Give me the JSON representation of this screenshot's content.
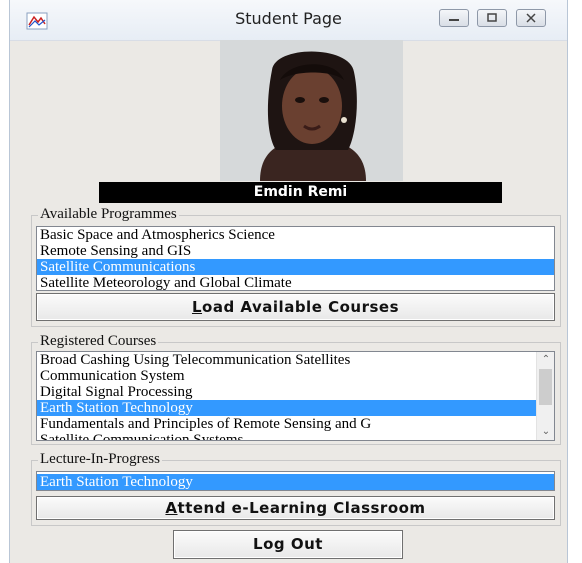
{
  "window": {
    "title": "Student Page"
  },
  "student": {
    "name": "Emdin Remi"
  },
  "programmes": {
    "legend": "Available Programmes",
    "items": [
      {
        "label": "Basic Space and Atmospherics Science",
        "selected": false
      },
      {
        "label": "Remote Sensing and GIS",
        "selected": false
      },
      {
        "label": "Satellite Communications",
        "selected": true
      },
      {
        "label": "Satellite Meteorology and Global Climate",
        "selected": false
      }
    ],
    "load_button": {
      "mnemonic": "L",
      "rest": "oad Available Courses"
    }
  },
  "courses": {
    "legend": "Registered Courses",
    "items": [
      {
        "label": "Broad Cashing Using Telecommunication Satellites",
        "selected": false
      },
      {
        "label": "Communication System",
        "selected": false
      },
      {
        "label": "Digital Signal Processing",
        "selected": false
      },
      {
        "label": "Earth Station Technology",
        "selected": true
      },
      {
        "label": "Fundamentals and Principles of Remote Sensing and G",
        "selected": false
      },
      {
        "label": "Satellite Communication Systems",
        "selected": false
      }
    ]
  },
  "lecture": {
    "legend": "Lecture-In-Progress",
    "items": [
      {
        "label": "Earth Station Technology",
        "selected": true
      }
    ],
    "attend_button": {
      "mnemonic": "A",
      "rest": "ttend e-Learning Classroom"
    }
  },
  "logout_button": "Log Out",
  "colors": {
    "selection": "#3399ff",
    "name_bar": "#000000",
    "window_bg": "#ebe9e5"
  }
}
